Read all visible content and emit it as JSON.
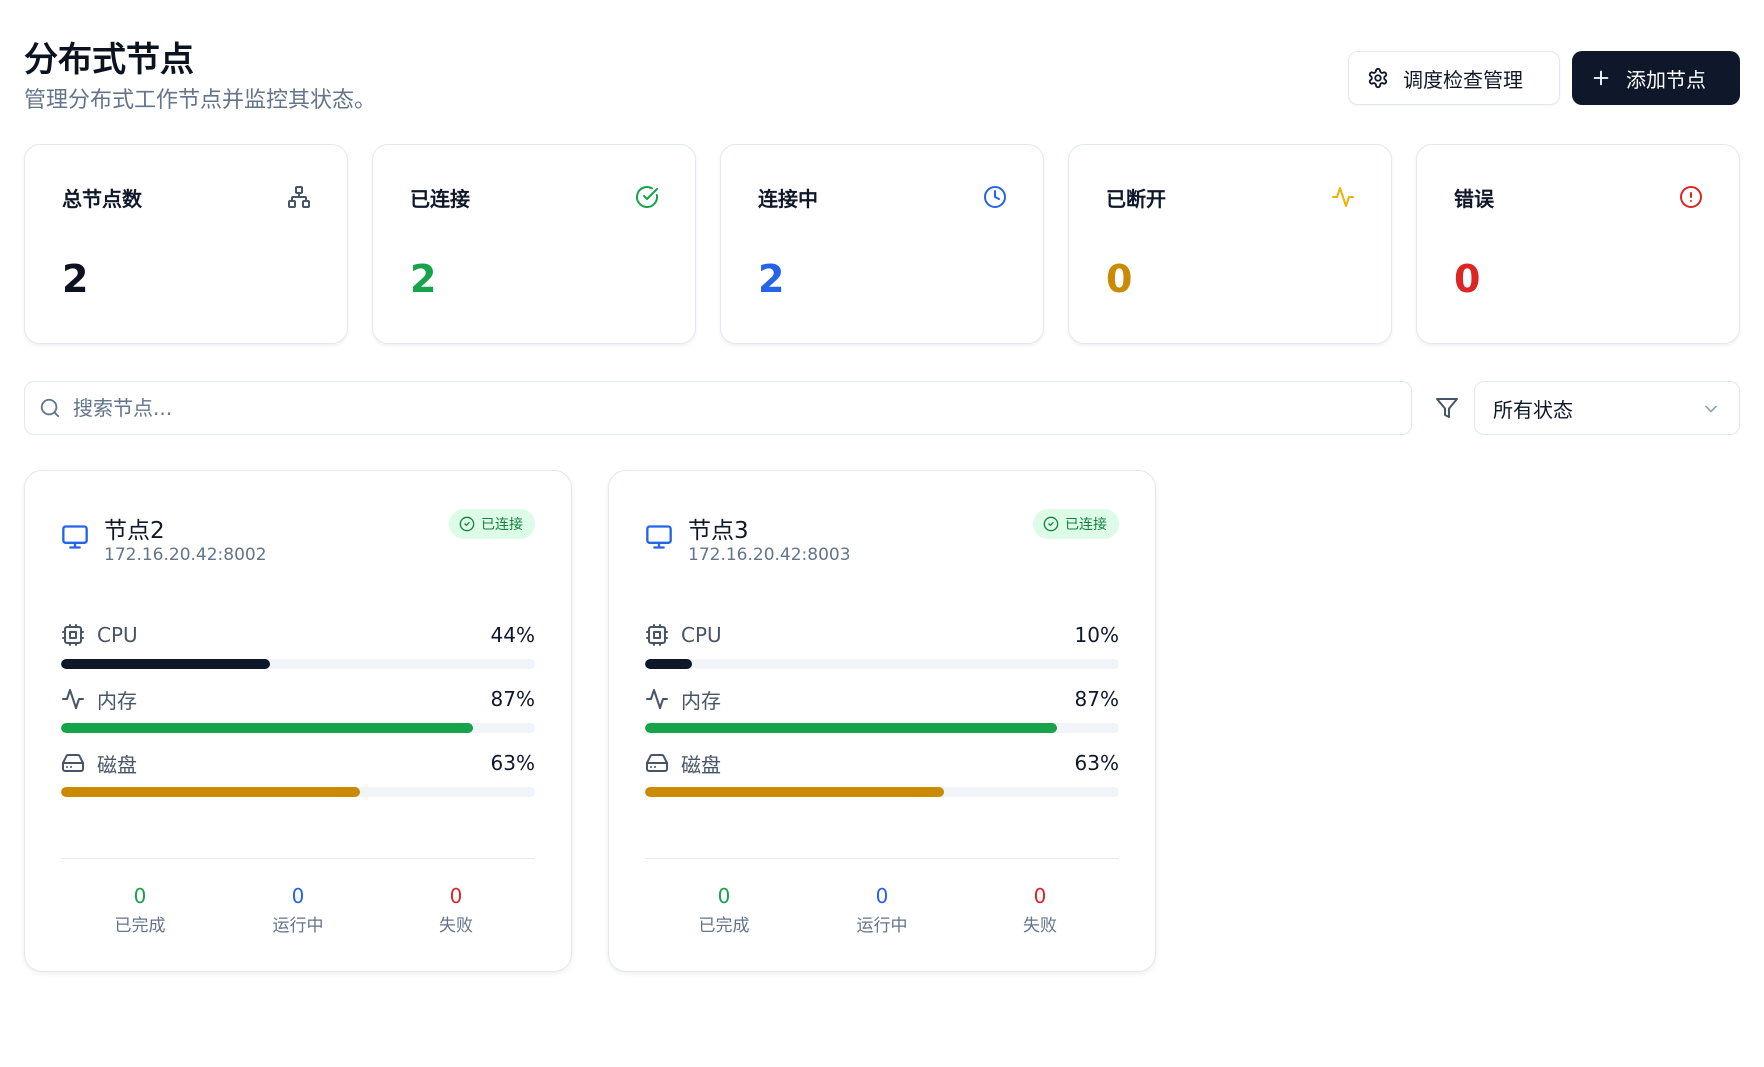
{
  "header": {
    "title": "分布式节点",
    "subtitle": "管理分布式工作节点并监控其状态。",
    "schedule_button": "调度检查管理",
    "add_button": "添加节点"
  },
  "stats": [
    {
      "label": "总节点数",
      "value": "2",
      "color": "#0b1220",
      "icon": "network-icon"
    },
    {
      "label": "已连接",
      "value": "2",
      "color": "#16a34a",
      "icon": "check-circle-icon"
    },
    {
      "label": "连接中",
      "value": "2",
      "color": "#2563eb",
      "icon": "clock-icon"
    },
    {
      "label": "已断开",
      "value": "0",
      "color": "#ca8a04",
      "icon": "activity-icon"
    },
    {
      "label": "错误",
      "value": "0",
      "color": "#dc2626",
      "icon": "alert-circle-icon"
    }
  ],
  "search": {
    "placeholder": "搜索节点..."
  },
  "filter": {
    "selected": "所有状态"
  },
  "nodes": [
    {
      "name": "节点2",
      "address": "172.16.20.42:8002",
      "status": "已连接",
      "metrics": [
        {
          "label": "CPU",
          "pct_text": "44%",
          "value": 44,
          "color": "#0f172a",
          "icon": "cpu-icon"
        },
        {
          "label": "内存",
          "pct_text": "87%",
          "value": 87,
          "color": "#16a34a",
          "icon": "activity-icon"
        },
        {
          "label": "磁盘",
          "pct_text": "63%",
          "value": 63,
          "color": "#ca8a04",
          "icon": "hard-drive-icon"
        }
      ],
      "tasks": [
        {
          "value": "0",
          "label": "已完成",
          "color": "#16a34a"
        },
        {
          "value": "0",
          "label": "运行中",
          "color": "#2563eb"
        },
        {
          "value": "0",
          "label": "失败",
          "color": "#dc2626"
        }
      ]
    },
    {
      "name": "节点3",
      "address": "172.16.20.42:8003",
      "status": "已连接",
      "metrics": [
        {
          "label": "CPU",
          "pct_text": "10%",
          "value": 10,
          "color": "#0f172a",
          "icon": "cpu-icon"
        },
        {
          "label": "内存",
          "pct_text": "87%",
          "value": 87,
          "color": "#16a34a",
          "icon": "activity-icon"
        },
        {
          "label": "磁盘",
          "pct_text": "63%",
          "value": 63,
          "color": "#ca8a04",
          "icon": "hard-drive-icon"
        }
      ],
      "tasks": [
        {
          "value": "0",
          "label": "已完成",
          "color": "#16a34a"
        },
        {
          "value": "0",
          "label": "运行中",
          "color": "#2563eb"
        },
        {
          "value": "0",
          "label": "失败",
          "color": "#dc2626"
        }
      ]
    }
  ]
}
